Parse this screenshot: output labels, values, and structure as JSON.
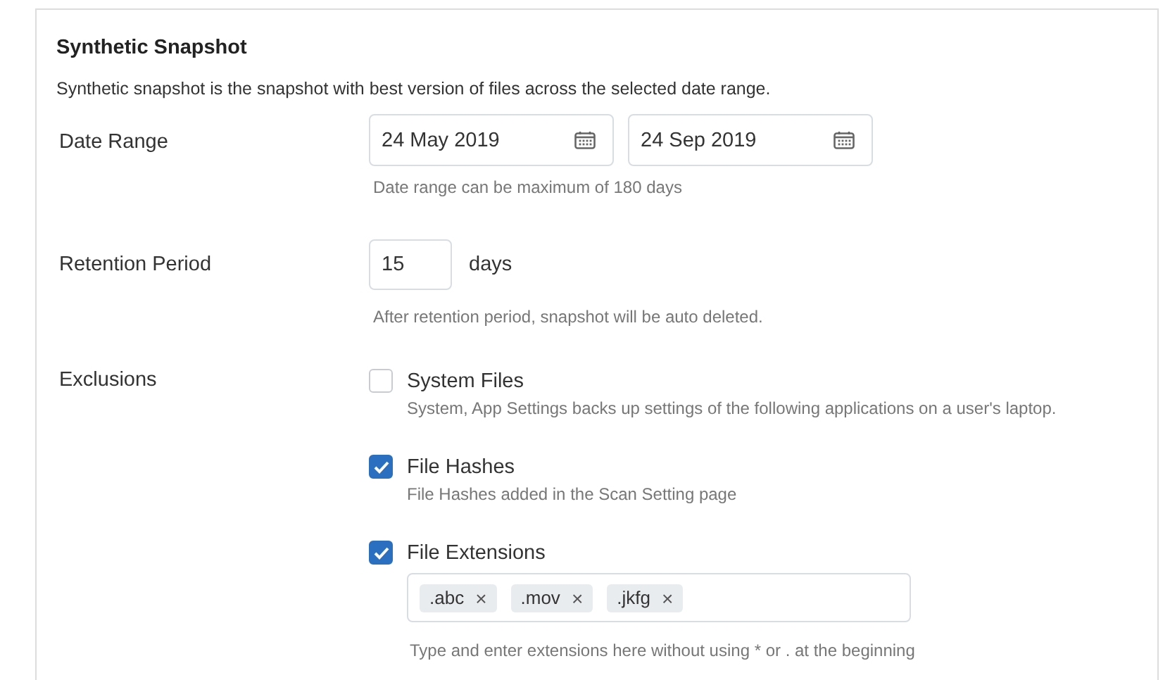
{
  "panel": {
    "title": "Synthetic Snapshot",
    "description": "Synthetic snapshot is the snapshot with best version of files across the selected date range."
  },
  "date_range": {
    "label": "Date Range",
    "from": "24 May 2019",
    "to": "24 Sep 2019",
    "hint": "Date range can be maximum of 180 days"
  },
  "retention": {
    "label": "Retention Period",
    "value": "15",
    "unit": "days",
    "hint": "After retention period, snapshot will be auto deleted."
  },
  "exclusions": {
    "label": "Exclusions",
    "options": [
      {
        "label": "System Files",
        "checked": false,
        "hint": "System, App Settings backs up settings of the following applications on a user's laptop."
      },
      {
        "label": "File Hashes",
        "checked": true,
        "hint": "File Hashes added in the Scan Setting page"
      },
      {
        "label": "File Extensions",
        "checked": true,
        "tags": [
          {
            "text": ".abc",
            "remove": "×"
          },
          {
            "text": ".mov",
            "remove": "×"
          },
          {
            "text": ".jkfg",
            "remove": "×"
          }
        ],
        "hint": "Type and enter extensions here without using * or . at the beginning"
      }
    ]
  }
}
